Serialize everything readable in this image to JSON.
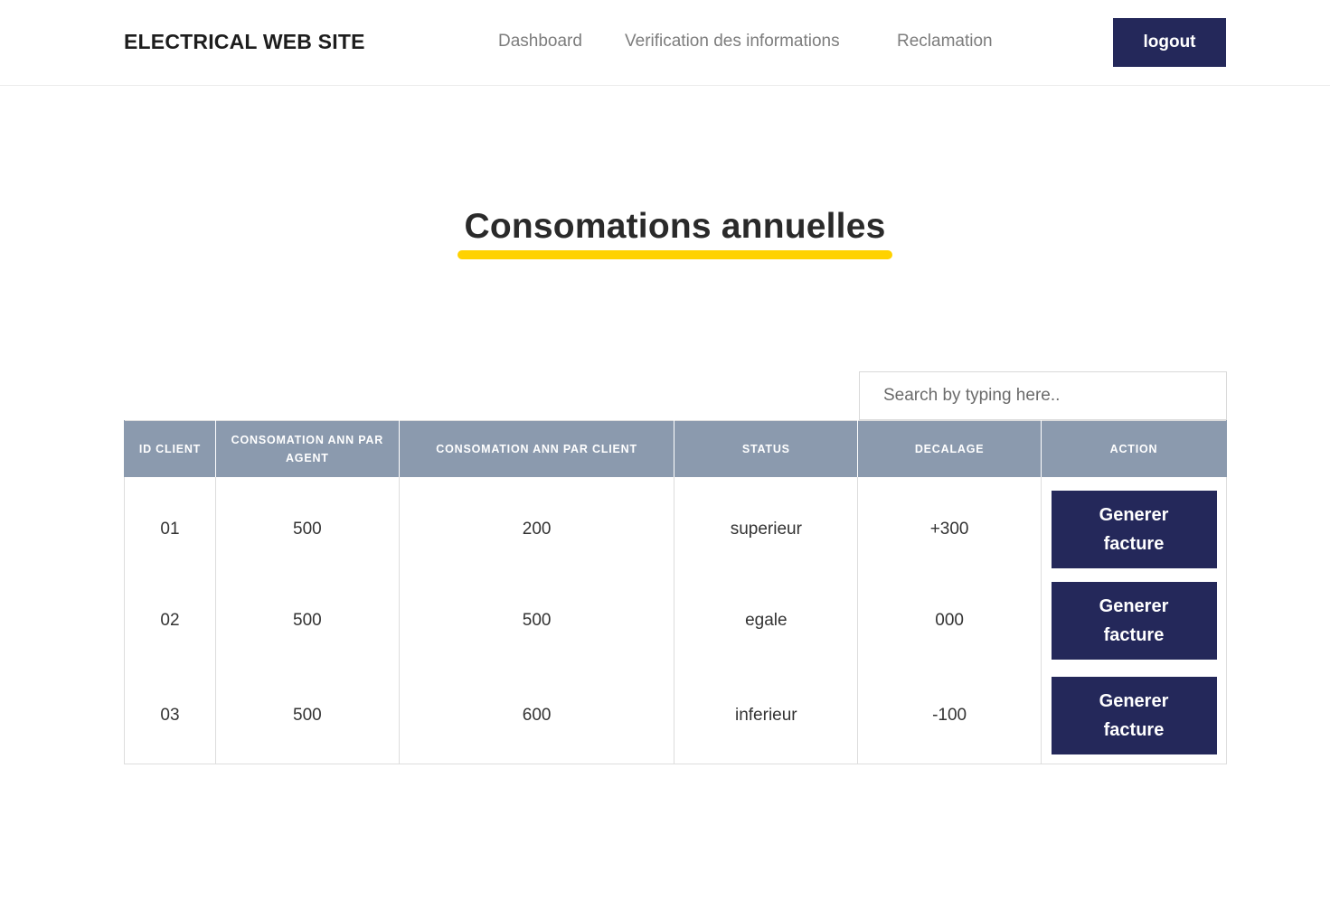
{
  "header": {
    "brand": "ELECTRICAL WEB SITE",
    "nav": [
      "Dashboard",
      "Verification des informations",
      "Reclamation"
    ],
    "logout_label": "logout"
  },
  "main": {
    "title": "Consomations annuelles",
    "accent_color": "#ffd200",
    "search_placeholder": "Search by typing here..",
    "table": {
      "headers": [
        "ID CLIENT",
        "CONSOMATION ANN PAR AGENT",
        "CONSOMATION ANN PAR CLIENT",
        "STATUS",
        "DECALAGE",
        "ACTION"
      ],
      "header_color": "#8b9aae",
      "rows": [
        {
          "id": "01",
          "agent": "500",
          "client": "200",
          "status": "superieur",
          "decalage": "+300",
          "action": "Generer facture"
        },
        {
          "id": "02",
          "agent": "500",
          "client": "500",
          "status": "egale",
          "decalage": "000",
          "action": "Generer facture"
        },
        {
          "id": "03",
          "agent": "500",
          "client": "600",
          "status": "inferieur",
          "decalage": "-100",
          "action": "Generer facture"
        }
      ]
    },
    "button_color": "#24285a"
  }
}
